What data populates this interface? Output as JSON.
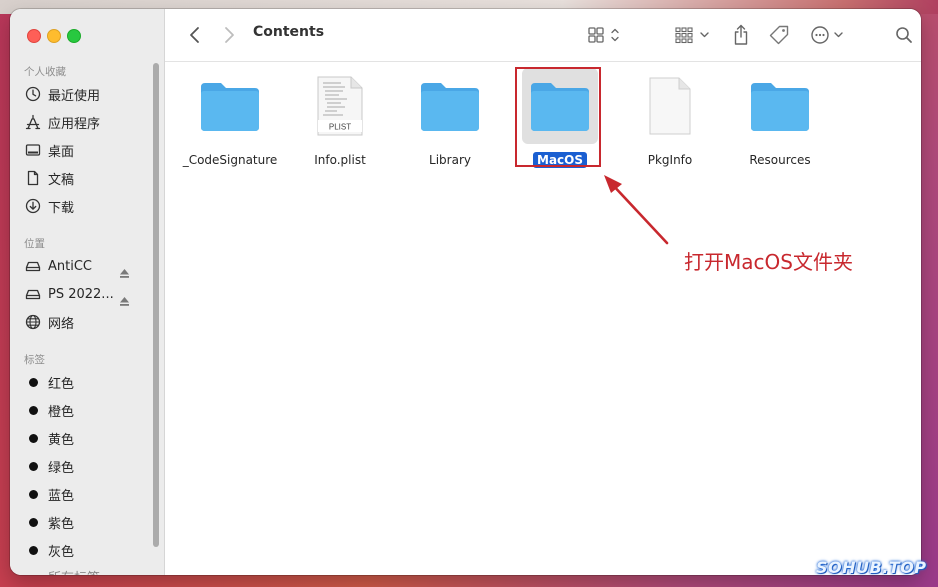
{
  "window": {
    "title": "Contents"
  },
  "sidebar": {
    "favorites_title": "个人收藏",
    "favorites": [
      {
        "label": "最近使用",
        "icon": "clock-icon"
      },
      {
        "label": "应用程序",
        "icon": "applications-icon"
      },
      {
        "label": "桌面",
        "icon": "desktop-icon"
      },
      {
        "label": "文稿",
        "icon": "document-icon"
      },
      {
        "label": "下载",
        "icon": "download-icon"
      }
    ],
    "locations_title": "位置",
    "locations": [
      {
        "label": "AntiCC",
        "icon": "drive-icon",
        "eject": true
      },
      {
        "label": "PS 2022...",
        "icon": "drive-icon",
        "eject": true
      },
      {
        "label": "网络",
        "icon": "network-icon",
        "eject": false
      }
    ],
    "tags_title": "标签",
    "tags": [
      {
        "label": "红色"
      },
      {
        "label": "橙色"
      },
      {
        "label": "黄色"
      },
      {
        "label": "绿色"
      },
      {
        "label": "蓝色"
      },
      {
        "label": "紫色"
      },
      {
        "label": "灰色"
      },
      {
        "label": "所有标签..."
      }
    ]
  },
  "files": [
    {
      "name": "_CodeSignature",
      "type": "folder",
      "selected": false
    },
    {
      "name": "Info.plist",
      "type": "plist",
      "badge": "PLIST",
      "selected": false
    },
    {
      "name": "Library",
      "type": "folder",
      "selected": false
    },
    {
      "name": "MacOS",
      "type": "folder",
      "selected": true
    },
    {
      "name": "PkgInfo",
      "type": "document",
      "selected": false
    },
    {
      "name": "Resources",
      "type": "folder",
      "selected": false
    }
  ],
  "annotation": {
    "text": "打开MacOS文件夹",
    "color": "#c8282e"
  },
  "watermark": {
    "text": "SOHUB.TOP"
  },
  "colors": {
    "folder": "#5ab8f0",
    "selection": "#1a5fd1",
    "accent_red": "#c8282e"
  }
}
